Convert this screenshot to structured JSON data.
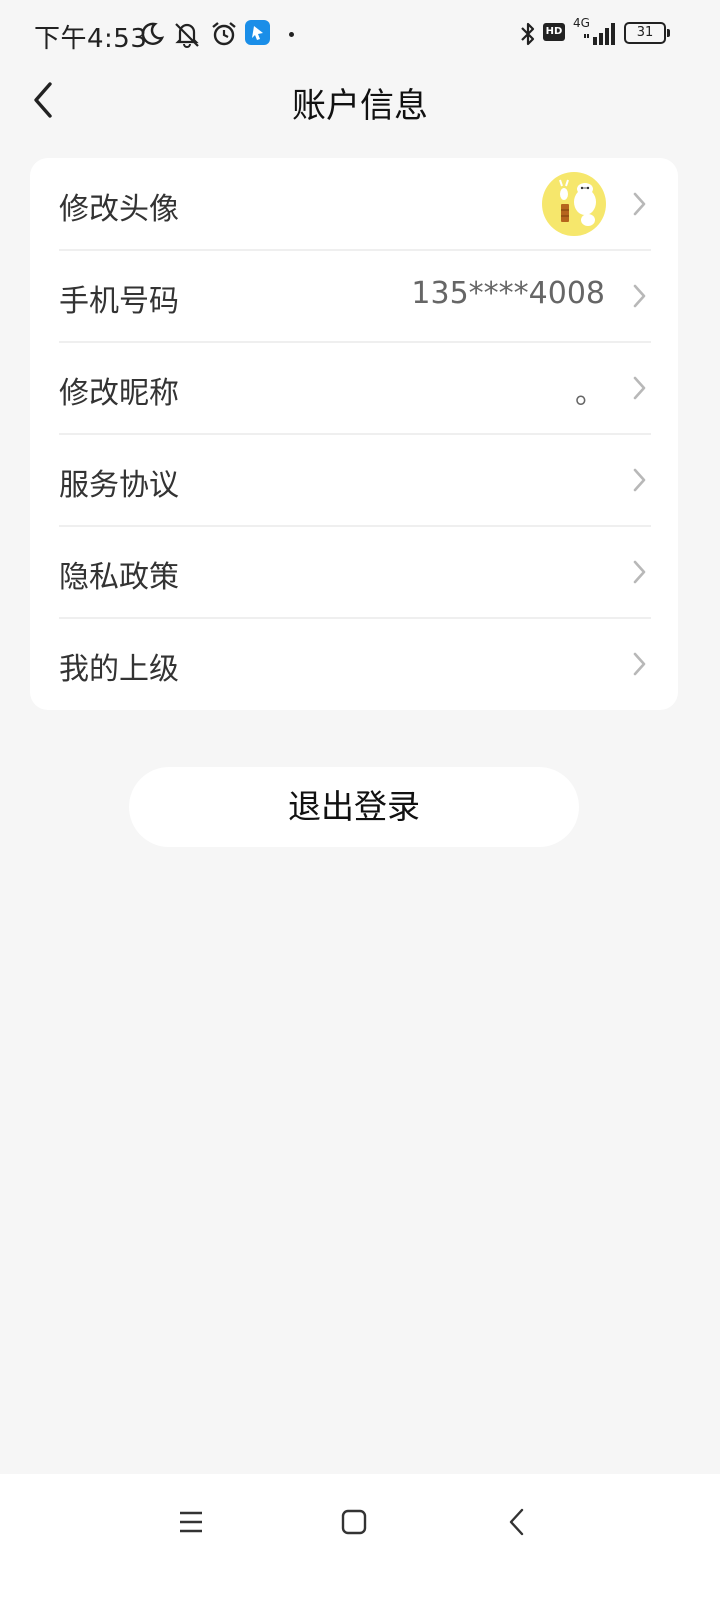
{
  "status_bar": {
    "time": "下午4:53",
    "icons": [
      "moon-icon",
      "bell-off-icon",
      "alarm-icon",
      "app-notification-icon",
      "bluetooth-icon",
      "hd-icon",
      "signal-icon",
      "battery-icon"
    ],
    "hd": "HD",
    "network": "4G",
    "battery": "31"
  },
  "header": {
    "title": "账户信息",
    "back_icon": "chevron-left-icon"
  },
  "account": {
    "rows": [
      {
        "label": "修改头像",
        "value": ""
      },
      {
        "label": "手机号码",
        "value": "135****4008"
      },
      {
        "label": "修改昵称",
        "value": "。"
      },
      {
        "label": "服务协议",
        "value": ""
      },
      {
        "label": "隐私政策",
        "value": ""
      },
      {
        "label": "我的上级",
        "value": ""
      }
    ]
  },
  "logout_label": "退出登录",
  "colors": {
    "background": "#f6f6f6",
    "card": "#ffffff",
    "avatar_bg": "#f6e76c",
    "app_badge": "#1a8ee8"
  },
  "nav": {
    "icons": [
      "menu-icon",
      "home-icon",
      "back-icon"
    ]
  }
}
